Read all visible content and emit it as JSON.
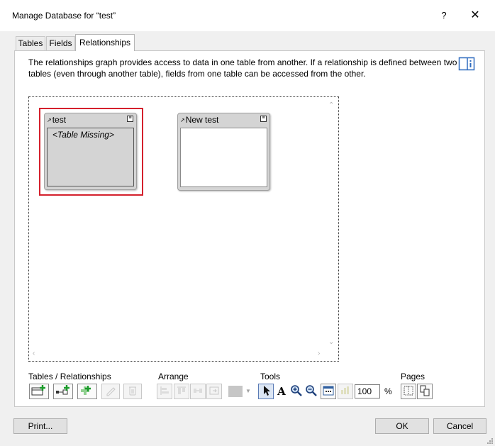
{
  "window": {
    "title": "Manage Database for “test”",
    "help_glyph": "?",
    "close_glyph": "✕"
  },
  "tabs": [
    {
      "label": "Tables",
      "active": false
    },
    {
      "label": "Fields",
      "active": false
    },
    {
      "label": "Relationships",
      "active": true
    }
  ],
  "description": "The relationships graph provides access to data in one table from another. If a relationship is defined between two tables (even through another table), fields from one table can be accessed from the other.",
  "graph": {
    "tables": [
      {
        "name": "test",
        "body_text": "<Table Missing>",
        "missing": true,
        "highlighted": true
      },
      {
        "name": "New test",
        "body_text": "",
        "missing": false,
        "highlighted": false
      }
    ],
    "highlight_color": "#d4202c"
  },
  "toolbar": {
    "tables_relationships_label": "Tables / Relationships",
    "arrange_label": "Arrange",
    "tools_label": "Tools",
    "pages_label": "Pages",
    "zoom_value": "100",
    "zoom_unit": "%",
    "tool_text_glyph": "A"
  },
  "buttons": {
    "print": "Print...",
    "ok": "OK",
    "cancel": "Cancel"
  }
}
